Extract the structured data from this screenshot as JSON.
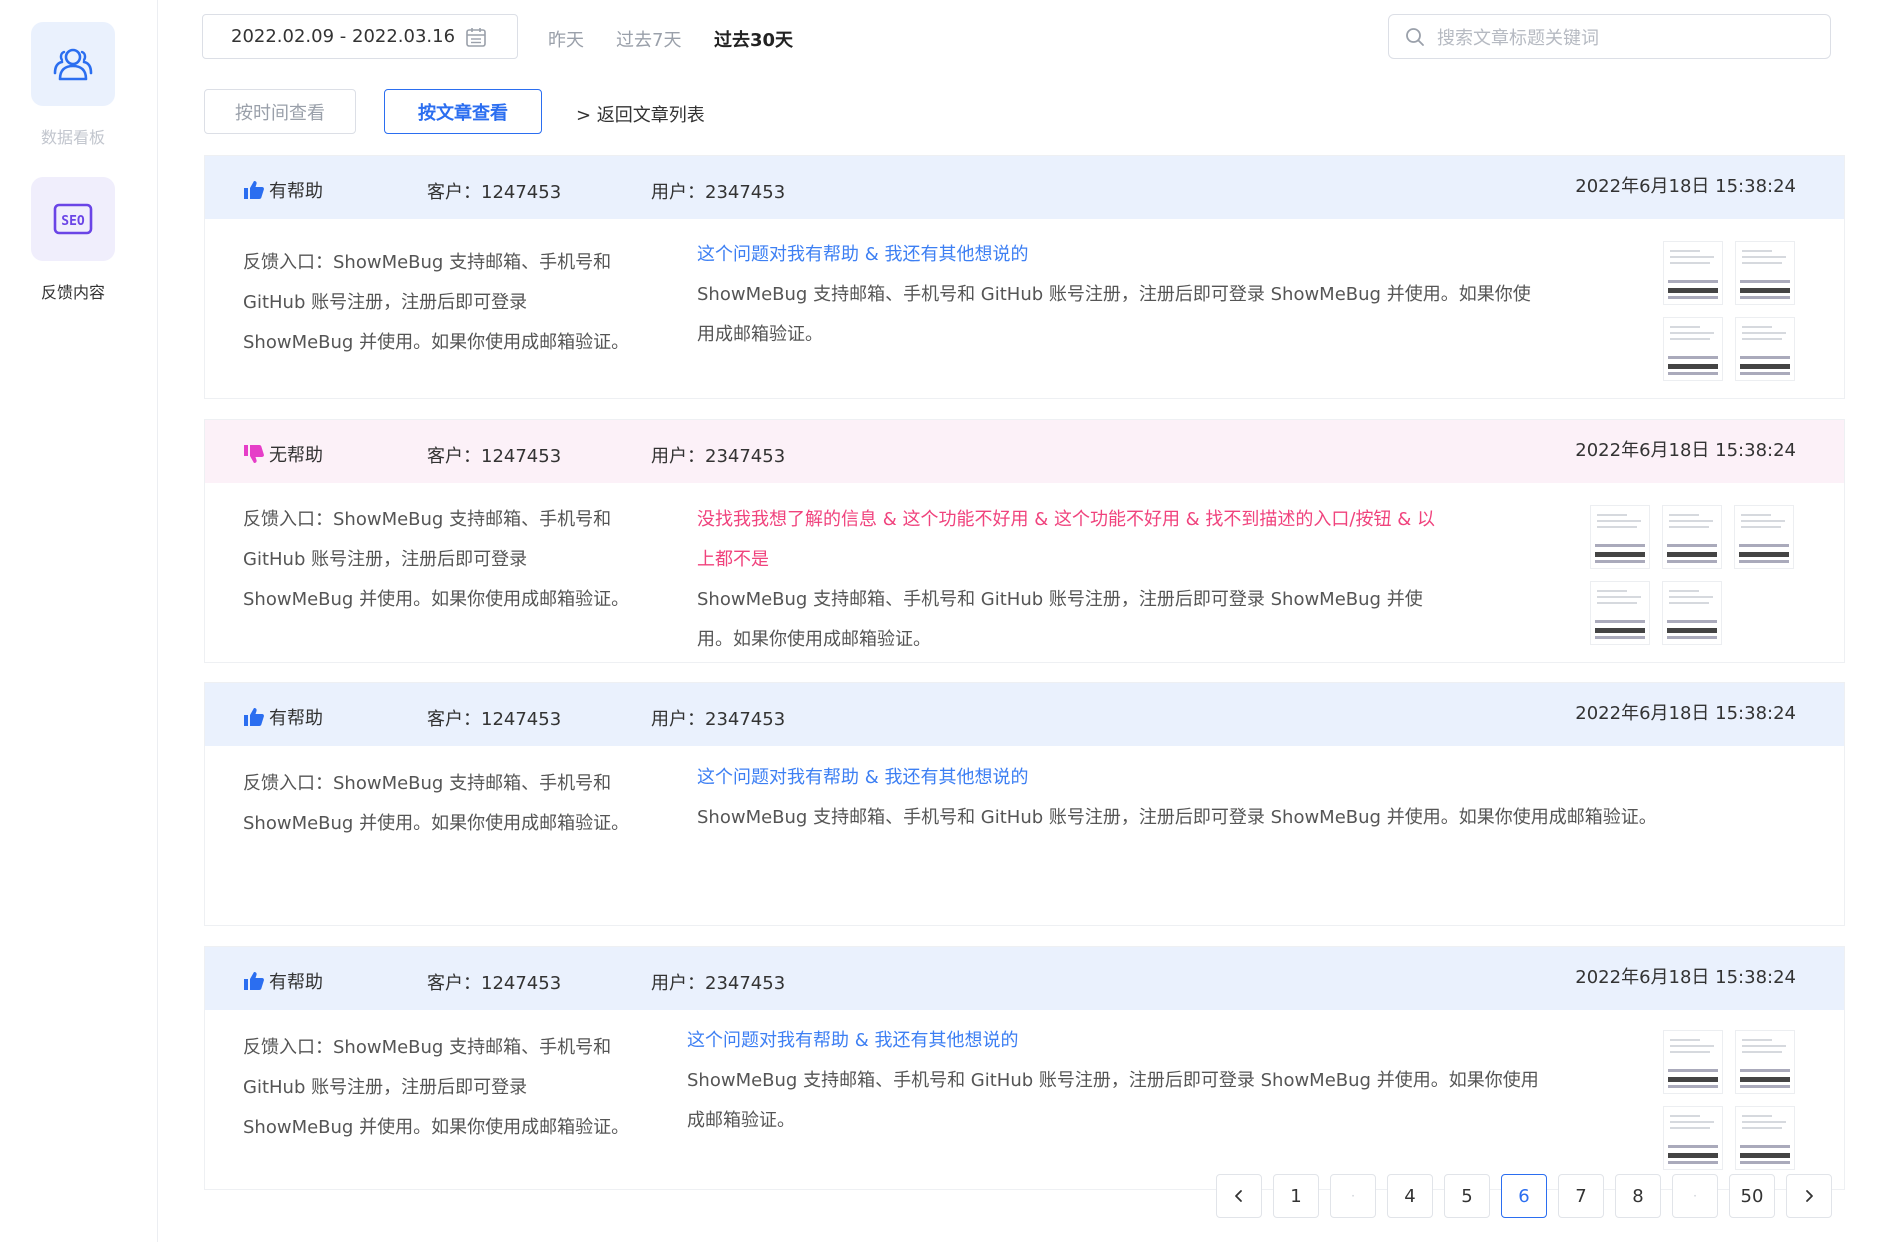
{
  "sidebar": {
    "items": [
      {
        "label": "数据看板",
        "icon": "users-icon"
      },
      {
        "label": "反馈内容",
        "icon": "seo-icon",
        "icon_text": "SEO"
      }
    ]
  },
  "toolbar": {
    "date_range": "2022.02.09 - 2022.03.16",
    "quick_ranges": [
      {
        "label": "昨天"
      },
      {
        "label": "过去7天"
      },
      {
        "label": "过去30天"
      }
    ],
    "search_placeholder": "搜索文章标题关键词",
    "view_by_time": "按时间查看",
    "view_by_article": "按文章查看",
    "back_link": "> 返回文章列表"
  },
  "colors": {
    "accent": "#2b6ef0",
    "helpful_option": "#3d7ff3",
    "unhelpful_option": "#f0437d",
    "thumb_up": "#2b6ef0",
    "thumb_down": "#e63ec8"
  },
  "feedback": [
    {
      "status": "有帮助",
      "customer": "客户：1247453",
      "user": "用户：2347453",
      "time": "2022年6月18日 15:38:24",
      "entry_lines": [
        "反馈入口：ShowMeBug 支持邮箱、手机号和",
        "GitHub 账号注册，注册后即可登录",
        "ShowMeBug 并使用。如果你使用成邮箱验证。"
      ],
      "options_lines": [
        "这个问题对我有帮助 & 我还有其他想说的"
      ],
      "desc_lines": [
        "ShowMeBug 支持邮箱、手机号和 GitHub 账号注册，注册后即可登录 ShowMeBug 并使用。如果你使",
        "用成邮箱验证。"
      ],
      "attachments": 4
    },
    {
      "status": "无帮助",
      "customer": "客户：1247453",
      "user": "用户：2347453",
      "time": "2022年6月18日 15:38:24",
      "entry_lines": [
        "反馈入口：ShowMeBug 支持邮箱、手机号和",
        "GitHub 账号注册，注册后即可登录",
        "ShowMeBug 并使用。如果你使用成邮箱验证。"
      ],
      "options_lines": [
        "没找我我想了解的信息 & 这个功能不好用 & 这个功能不好用 & 找不到描述的入口/按钮 & 以",
        "上都不是"
      ],
      "desc_lines": [
        "ShowMeBug 支持邮箱、手机号和 GitHub 账号注册，注册后即可登录 ShowMeBug 并使",
        "用。如果你使用成邮箱验证。"
      ],
      "attachments": 5
    },
    {
      "status": "有帮助",
      "customer": "客户：1247453",
      "user": "用户：2347453",
      "time": "2022年6月18日 15:38:24",
      "entry_lines": [
        "反馈入口：ShowMeBug 支持邮箱、手机号和",
        "ShowMeBug 并使用。如果你使用成邮箱验证。"
      ],
      "options_lines": [
        "这个问题对我有帮助 & 我还有其他想说的"
      ],
      "desc_lines": [
        "ShowMeBug 支持邮箱、手机号和 GitHub 账号注册，注册后即可登录 ShowMeBug 并使用。如果你使用成邮箱验证。"
      ],
      "attachments": 0
    },
    {
      "status": "有帮助",
      "customer": "客户：1247453",
      "user": "用户：2347453",
      "time": "2022年6月18日 15:38:24",
      "entry_lines": [
        "反馈入口：ShowMeBug 支持邮箱、手机号和",
        "GitHub 账号注册，注册后即可登录",
        "ShowMeBug 并使用。如果你使用成邮箱验证。"
      ],
      "options_lines": [
        "这个问题对我有帮助 & 我还有其他想说的"
      ],
      "desc_lines": [
        "ShowMeBug 支持邮箱、手机号和 GitHub 账号注册，注册后即可登录 ShowMeBug 并使用。如果你使用",
        "成邮箱验证。"
      ],
      "attachments": 4
    }
  ],
  "pagination": {
    "pages": [
      "1",
      "4",
      "5",
      "6",
      "7",
      "8",
      "50"
    ],
    "current": "6"
  }
}
